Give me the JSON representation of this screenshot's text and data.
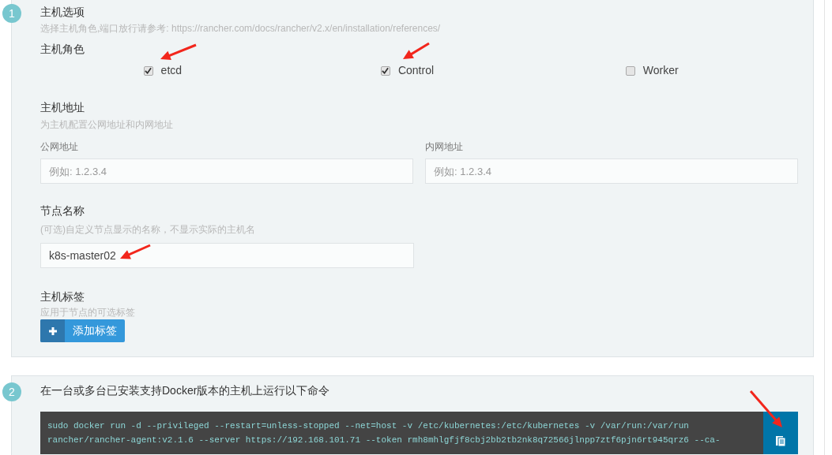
{
  "host_options": {
    "step": "1",
    "title": "主机选项",
    "hint": "选择主机角色,端口放行请参考: https://rancher.com/docs/rancher/v2.x/en/installation/references/",
    "roles_label": "主机角色",
    "roles": [
      {
        "label": "etcd",
        "checked": true
      },
      {
        "label": "Control",
        "checked": true
      },
      {
        "label": "Worker",
        "checked": false
      }
    ],
    "address": {
      "title": "主机地址",
      "hint": "为主机配置公网地址和内网地址",
      "fields": [
        {
          "label": "公网地址",
          "placeholder": "例如: 1.2.3.4"
        },
        {
          "label": "内网地址",
          "placeholder": "例如: 1.2.3.4"
        }
      ]
    },
    "node_name": {
      "title": "节点名称",
      "hint": "(可选)自定义节点显示的名称，不显示实际的主机名",
      "value": "k8s-master02"
    },
    "labels": {
      "title": "主机标签",
      "hint": "应用于节点的可选标签",
      "add_button": "添加标签"
    }
  },
  "run_command": {
    "step": "2",
    "title": "在一台或多台已安装支持Docker版本的主机上运行以下命令",
    "command_lines": [
      "sudo docker run -d --privileged --restart=unless-stopped --net=host -v /etc/kubernetes:/etc/kubernetes -v /var/run:/var/run",
      "rancher/rancher-agent:v2.1.6 --server https://192.168.101.71 --token rmh8mhlgfjf8cbj2bb2tb2nk8q72566jlnpp7ztf6pjn6rt945qrz6 --ca-"
    ]
  }
}
